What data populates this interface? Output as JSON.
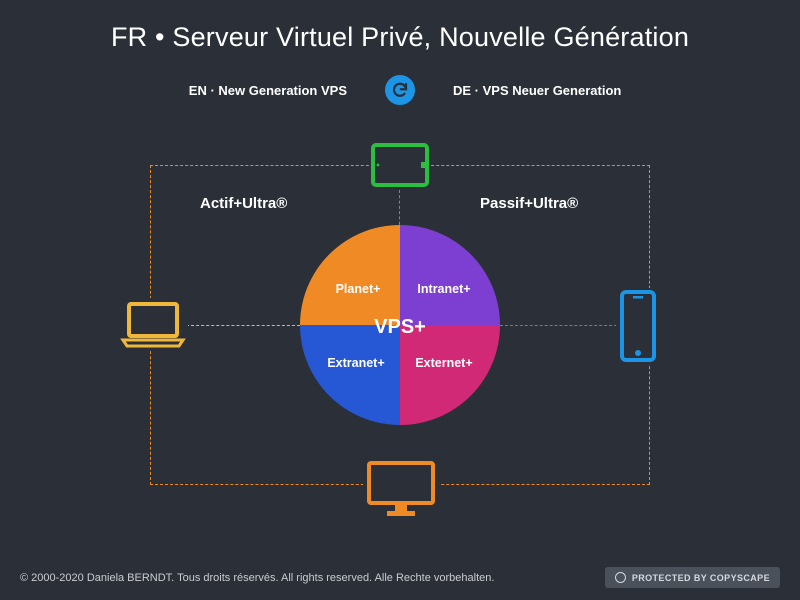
{
  "title": "FR • Serveur Virtuel Privé, Nouvelle Génération",
  "subtitles": {
    "en": "EN · New Generation VPS",
    "de": "DE · VPS Neuer Generation"
  },
  "categories": {
    "left": "Actif+Ultra®",
    "right": "Passif+Ultra®"
  },
  "quadrants": {
    "tl": "Planet+",
    "tr": "Intranet+",
    "bl": "Extranet+",
    "br": "Externet+"
  },
  "center": "VPS+",
  "colors": {
    "bg": "#2b3038",
    "orange": "#f08a24",
    "purple": "#7d3fd1",
    "blue": "#2658d6",
    "magenta": "#d22977",
    "green": "#2bbf42",
    "yellow": "#f0b83b",
    "skyblue": "#1c95e6"
  },
  "footer": {
    "copyright": "© 2000-2020 Daniela BERNDT. Tous droits réservés. All rights reserved. Alle Rechte vorbehalten.",
    "badge": "PROTECTED BY COPYSCAPE"
  }
}
